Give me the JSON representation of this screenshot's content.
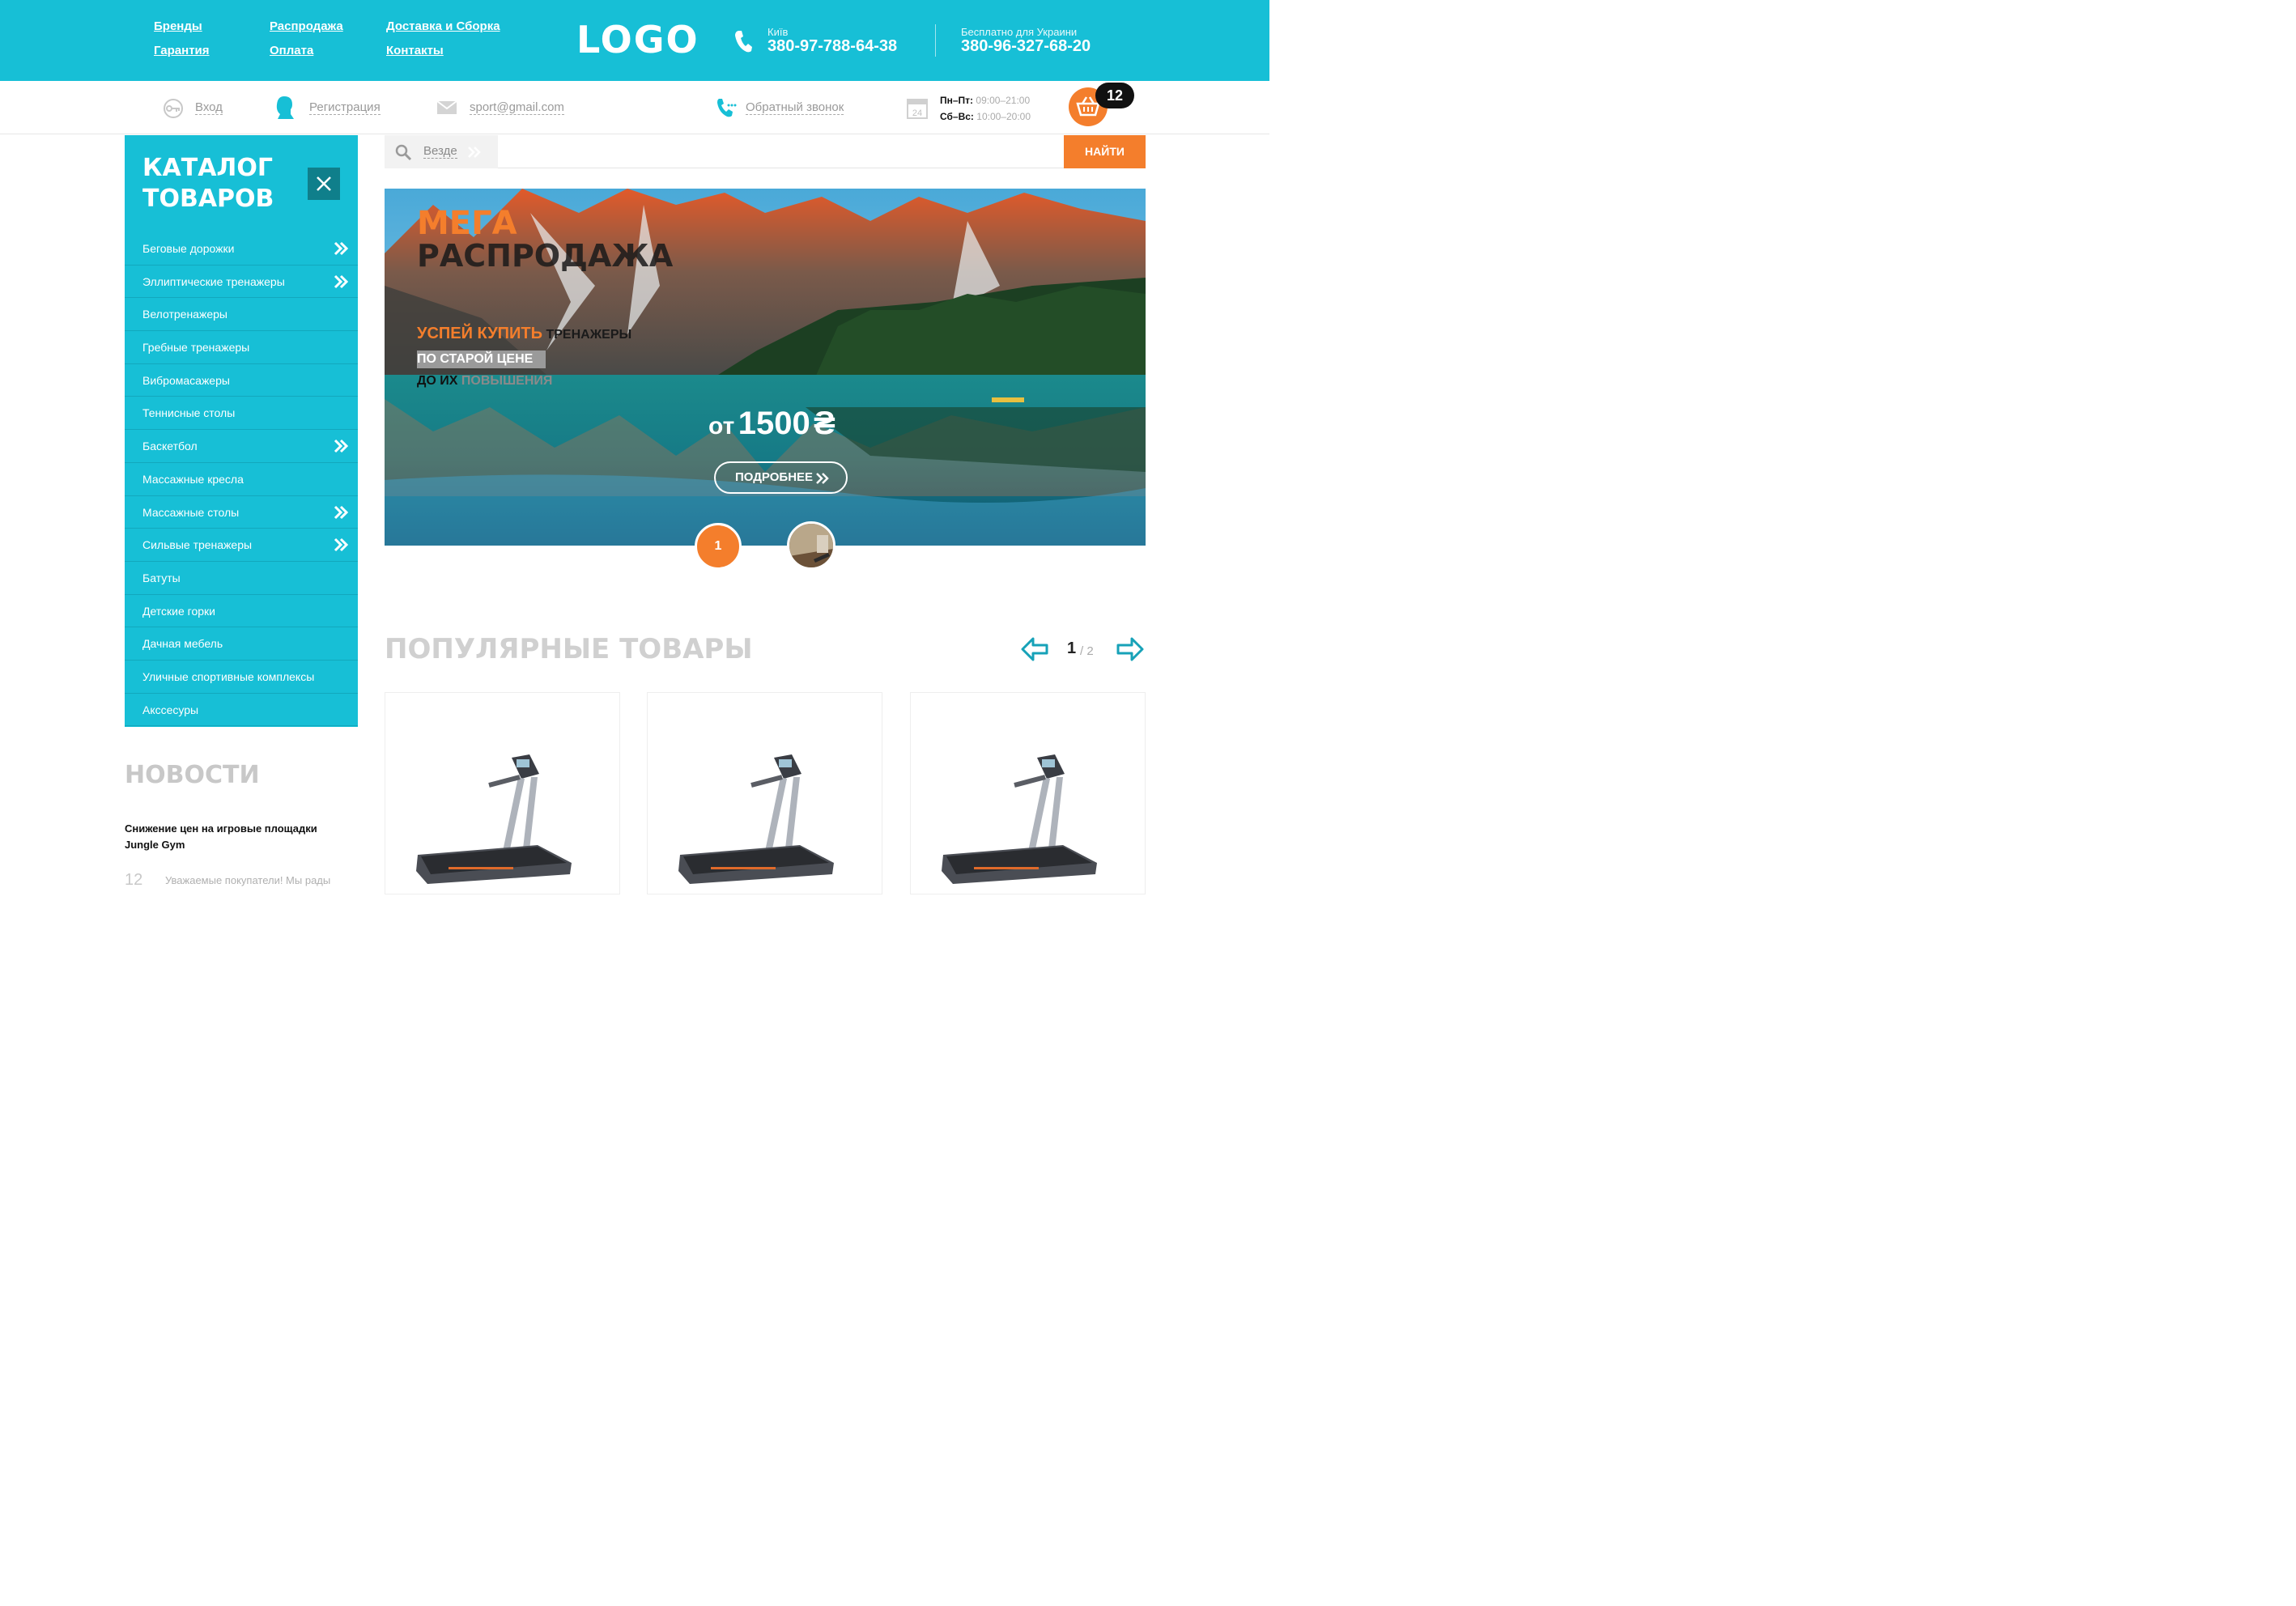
{
  "topnav": {
    "col1": [
      "Бренды",
      "Гарантия"
    ],
    "col2": [
      "Распродажа",
      "Оплата"
    ],
    "col3": [
      "Доставка и Сборка",
      "Контакты"
    ]
  },
  "logo": "LOGO",
  "contacts": {
    "city_label": "Київ",
    "phone_city": "380-97-788-64-38",
    "free_label": "Бесплатно для Украини",
    "phone_free": "380-96-327-68-20"
  },
  "subbar": {
    "login": "Вход",
    "register": "Регистрация",
    "email": "sport@gmail.com",
    "callback": "Обратный звонок",
    "hours": [
      {
        "days": "Пн–Пт:",
        "time": "09:00–21:00"
      },
      {
        "days": "Сб–Вс:",
        "time": "10:00–20:00"
      }
    ],
    "calendar_number": "24",
    "cart_count": "12"
  },
  "catalog": {
    "title_line1": "КАТАЛОГ",
    "title_line2": "ТОВАРОВ",
    "items": [
      {
        "label": "Беговые дорожки",
        "submenu": true
      },
      {
        "label": "Эллиптические тренажеры",
        "submenu": true
      },
      {
        "label": "Велотренажеры",
        "submenu": false
      },
      {
        "label": "Гребные тренажеры",
        "submenu": false
      },
      {
        "label": "Вибромасажеры",
        "submenu": false
      },
      {
        "label": "Теннисные столы",
        "submenu": false
      },
      {
        "label": "Баскетбол",
        "submenu": true
      },
      {
        "label": "Массажные кресла",
        "submenu": false
      },
      {
        "label": "Массажные столы",
        "submenu": true
      },
      {
        "label": "Сильвые тренажеры",
        "submenu": true
      },
      {
        "label": "Батуты",
        "submenu": false
      },
      {
        "label": "Детские горки",
        "submenu": false
      },
      {
        "label": "Дачная мебель",
        "submenu": false
      },
      {
        "label": "Уличные спортивные комплексы",
        "submenu": false
      },
      {
        "label": "Акссесуры",
        "submenu": false
      }
    ]
  },
  "search": {
    "scope": "Везде",
    "value": "",
    "button": "НАЙТИ"
  },
  "banner": {
    "title1": "МЕГА",
    "title2": "РАСПРОДАЖА",
    "line1_accent": "УСПЕЙ КУПИТЬ",
    "line1_dark": "ТРЕНАЖЕРЫ",
    "line2": "ПО СТАРОЙ ЦЕНЕ",
    "line3_dark": "ДО ИХ",
    "line3_grey": "ПОВЫШЕНИЯ",
    "price_prefix": "от",
    "price": "1500",
    "currency": "₴",
    "button": "ПОДРОБНЕЕ",
    "slide_current": "1"
  },
  "popular": {
    "title": "ПОПУЛЯРНЫЕ ТОВАРЫ",
    "page_current": "1",
    "page_total": "/ 2"
  },
  "news": {
    "title": "НОВОСТИ",
    "headline": "Снижение цен на игровые площадки Jungle Gym",
    "date": "12",
    "excerpt": "Уважаемые покупатели! Мы рады"
  },
  "colors": {
    "primary": "#17bfd6",
    "accent": "#f47e2c",
    "dark": "#111111"
  }
}
